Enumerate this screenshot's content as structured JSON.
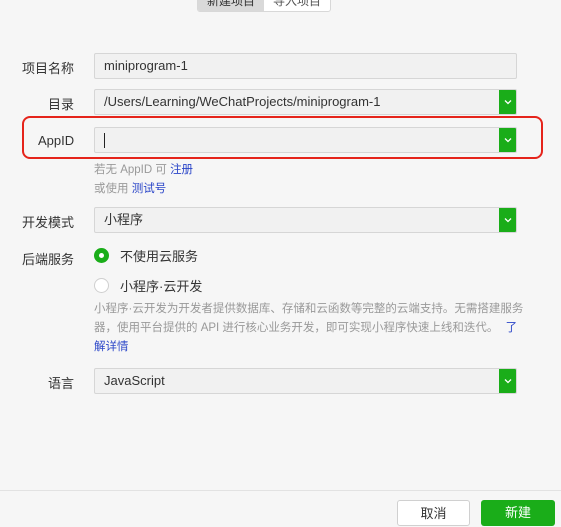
{
  "tabs": [
    {
      "label": "新建项目",
      "active": true
    },
    {
      "label": "导入项目",
      "active": false
    }
  ],
  "form": {
    "project_name": {
      "label": "项目名称",
      "value": "miniprogram-1"
    },
    "directory": {
      "label": "目录",
      "value": "/Users/Learning/WeChatProjects/miniprogram-1"
    },
    "appid": {
      "label": "AppID",
      "value": "",
      "hint_register_prefix": "若无 AppID 可",
      "hint_register_link": "注册",
      "hint_test_prefix": "或使用",
      "hint_test_link": "测试号"
    },
    "dev_mode": {
      "label": "开发模式",
      "value": "小程序"
    },
    "backend": {
      "label": "后端服务",
      "options": [
        {
          "label": "不使用云服务",
          "checked": true
        },
        {
          "label": "小程序·云开发",
          "checked": false
        }
      ],
      "description": "小程序·云开发为开发者提供数据库、存储和云函数等完整的云端支持。无需搭建服务器，使用平台提供的 API 进行核心业务开发，即可实现小程序快速上线和迭代。",
      "learn_more": "了解详情"
    },
    "language": {
      "label": "语言",
      "value": "JavaScript"
    }
  },
  "footer": {
    "cancel_label": "取消",
    "create_label": "新建"
  },
  "colors": {
    "accent": "#1aad19",
    "highlight": "#e5241b",
    "link": "#2a45c8"
  }
}
